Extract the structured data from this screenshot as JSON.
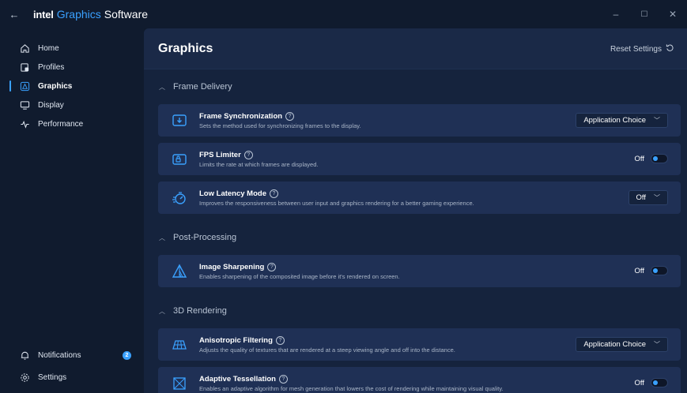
{
  "window": {
    "back_glyph": "←",
    "brand_intel": "intel",
    "brand_graphics": "Graphics",
    "brand_software": "Software",
    "controls": {
      "minimize": "–",
      "maximize": "☐",
      "close": "✕"
    }
  },
  "sidebar": {
    "items": [
      {
        "label": "Home",
        "icon": "home-icon"
      },
      {
        "label": "Profiles",
        "icon": "profiles-icon"
      },
      {
        "label": "Graphics",
        "icon": "graphics-icon",
        "active": true
      },
      {
        "label": "Display",
        "icon": "display-icon"
      },
      {
        "label": "Performance",
        "icon": "performance-icon"
      }
    ],
    "bottom": [
      {
        "label": "Notifications",
        "icon": "bell-icon",
        "badge": "2"
      },
      {
        "label": "Settings",
        "icon": "gear-icon"
      }
    ]
  },
  "main": {
    "title": "Graphics",
    "reset_label": "Reset Settings",
    "sections": [
      {
        "title": "Frame Delivery",
        "cards": [
          {
            "title": "Frame Synchronization",
            "desc": "Sets the method used for synchronizing frames to the display.",
            "control": "dropdown",
            "value": "Application Choice"
          },
          {
            "title": "FPS Limiter",
            "desc": "Limits the rate at which frames are displayed.",
            "control": "toggle",
            "value": "Off"
          },
          {
            "title": "Low Latency Mode",
            "desc": "Improves the responsiveness between user input and graphics rendering for a better gaming experience.",
            "control": "dropdown",
            "value": "Off"
          }
        ]
      },
      {
        "title": "Post-Processing",
        "cards": [
          {
            "title": "Image Sharpening",
            "desc": "Enables sharpening of the composited image before it's rendered on screen.",
            "control": "toggle",
            "value": "Off"
          }
        ]
      },
      {
        "title": "3D Rendering",
        "cards": [
          {
            "title": "Anisotropic Filtering",
            "desc": "Adjusts the quality of textures that are rendered at a steep viewing angle and off into the distance.",
            "control": "dropdown",
            "value": "Application Choice"
          },
          {
            "title": "Adaptive Tessellation",
            "desc": "Enables an adaptive algorithm for mesh generation that lowers the cost of rendering while maintaining visual quality.",
            "control": "toggle",
            "value": "Off"
          }
        ]
      }
    ]
  },
  "colors": {
    "accent": "#3aa1ff",
    "sidebar_bg": "#101b2e",
    "main_bg": "#15233d",
    "card_bg": "#1f3055"
  }
}
